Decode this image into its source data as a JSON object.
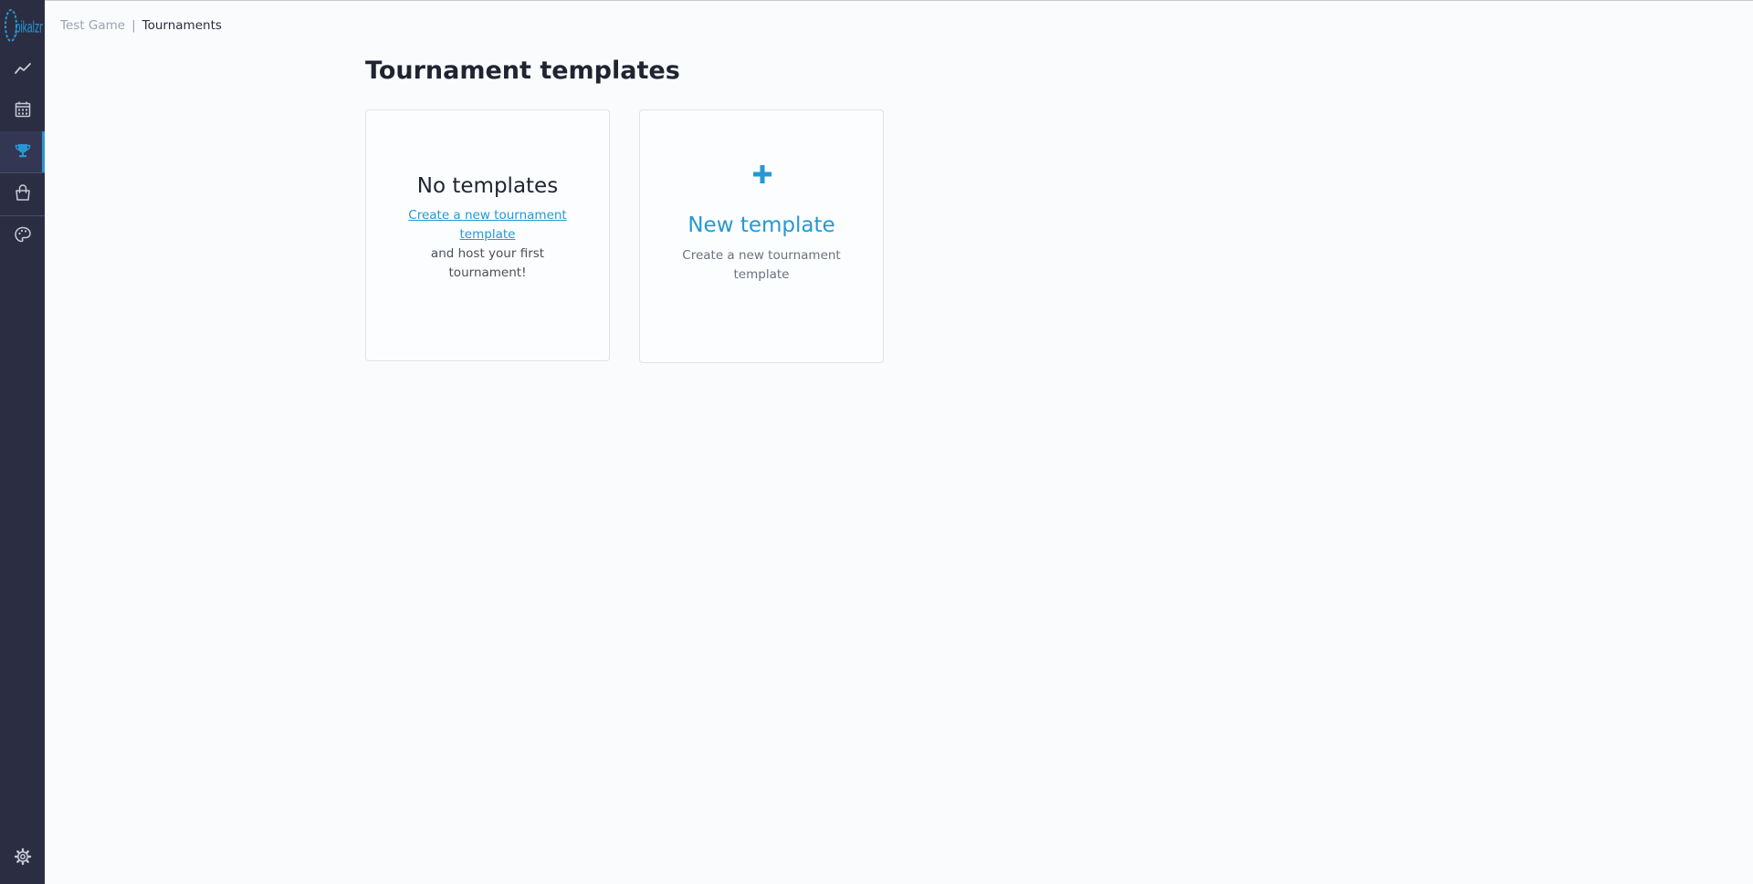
{
  "breadcrumb": {
    "parent": "Test Game",
    "separator": "|",
    "current": "Tournaments"
  },
  "sidebar": {
    "logo": "logo",
    "accent_color": "#2798d2",
    "items": [
      {
        "icon": "chart-line-icon",
        "active": false
      },
      {
        "icon": "calendar-icon",
        "active": false
      },
      {
        "icon": "trophy-icon",
        "active": true
      },
      {
        "icon": "shopping-bag-icon",
        "active": false
      },
      {
        "icon": "palette-icon",
        "active": false
      }
    ],
    "settings_icon": "gear-icon"
  },
  "page": {
    "title": "Tournament templates"
  },
  "empty_card": {
    "title": "No templates",
    "link": "Create a new tournament template",
    "text": "and host your first tournament!"
  },
  "new_card": {
    "icon": "plus-icon",
    "title": "New template",
    "description": "Create a new tournament template"
  }
}
